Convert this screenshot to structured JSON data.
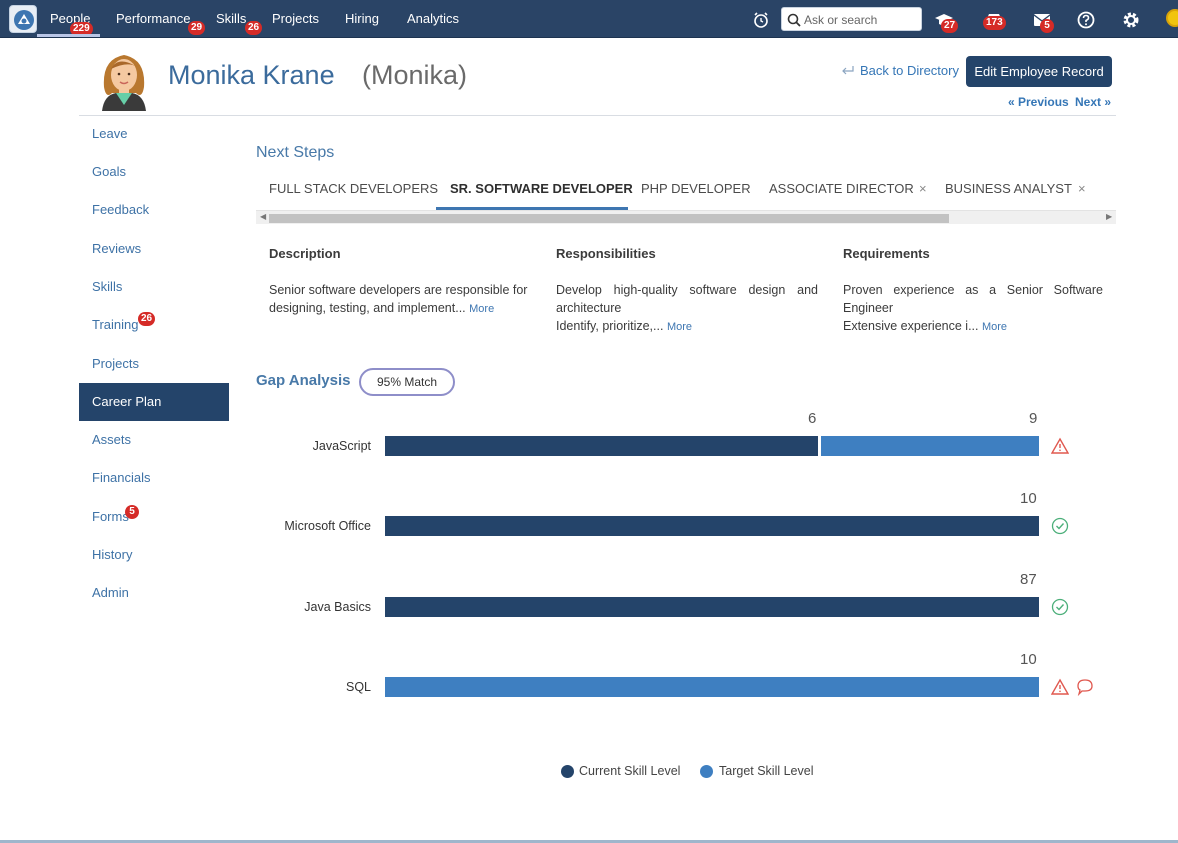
{
  "nav": {
    "items": [
      {
        "label": "People",
        "badge": "229"
      },
      {
        "label": "Performance",
        "badge": "29"
      },
      {
        "label": "Skills",
        "badge": "26"
      },
      {
        "label": "Projects",
        "badge": ""
      },
      {
        "label": "Hiring",
        "badge": ""
      },
      {
        "label": "Analytics",
        "badge": ""
      }
    ],
    "search_placeholder": "Ask or search",
    "icons": {
      "alarm": "alarm-clock-icon",
      "courses": "graduation-cap-icon",
      "courses_badge": "27",
      "inbox": "inbox-icon",
      "inbox_badge": "173",
      "messages": "envelope-icon",
      "messages_badge": "5",
      "help": "help-icon",
      "settings": "gear-icon"
    }
  },
  "header": {
    "name": "Monika Krane",
    "nickname": "(Monika)",
    "back_link": "Back to Directory",
    "edit_button": "Edit Employee Record",
    "previous": "« Previous",
    "next": "Next »"
  },
  "sidebar": {
    "items": [
      {
        "label": "Leave",
        "badge": ""
      },
      {
        "label": "Goals",
        "badge": ""
      },
      {
        "label": "Feedback",
        "badge": ""
      },
      {
        "label": "Reviews",
        "badge": ""
      },
      {
        "label": "Skills",
        "badge": ""
      },
      {
        "label": "Training",
        "badge": "26"
      },
      {
        "label": "Projects",
        "badge": ""
      },
      {
        "label": "Career Plan",
        "badge": ""
      },
      {
        "label": "Assets",
        "badge": ""
      },
      {
        "label": "Financials",
        "badge": ""
      },
      {
        "label": "Forms",
        "badge": "5"
      },
      {
        "label": "History",
        "badge": ""
      },
      {
        "label": "Admin",
        "badge": ""
      }
    ],
    "active": "Career Plan"
  },
  "next_steps": {
    "title": "Next Steps",
    "tabs": [
      {
        "label": "FULL STACK DEVELOPERS",
        "closable": false
      },
      {
        "label": "SR. SOFTWARE DEVELOPER",
        "closable": false
      },
      {
        "label": "PHP DEVELOPER",
        "closable": false
      },
      {
        "label": "ASSOCIATE DIRECTOR",
        "closable": true
      },
      {
        "label": "BUSINESS ANALYST",
        "closable": true
      }
    ],
    "active_tab": "SR. SOFTWARE DEVELOPER",
    "close_glyph": "×",
    "columns": [
      {
        "heading": "Description",
        "text": "Senior software developers are responsible for designing, testing, and implement...",
        "more": "More"
      },
      {
        "heading": "Responsibilities",
        "text": "Develop high-quality software design and architecture\nIdentify, prioritize,...",
        "more": "More"
      },
      {
        "heading": "Requirements",
        "text": "Proven experience as a Senior Software Engineer\nExtensive experience i...",
        "more": "More"
      }
    ]
  },
  "gap_analysis": {
    "title": "Gap Analysis",
    "match": "95% Match"
  },
  "chart_data": {
    "type": "bar",
    "orientation": "horizontal",
    "stacked": true,
    "categories": [
      "JavaScript",
      "Microsoft Office",
      "Java Basics",
      "SQL"
    ],
    "series": [
      {
        "name": "Current Skill Level",
        "color": "#24446a",
        "values": [
          6,
          10,
          87,
          0
        ]
      },
      {
        "name": "Target Skill Level",
        "color": "#3e7fc1",
        "values": [
          3,
          0,
          0,
          10
        ]
      }
    ],
    "value_labels": [
      [
        "6",
        "9"
      ],
      [
        "10"
      ],
      [
        "87"
      ],
      [
        "10"
      ]
    ],
    "status": [
      "warning-icon",
      "check-icon",
      "check-icon",
      "warning-icon"
    ],
    "extra_icons": [
      "",
      "",
      "",
      "comment-icon"
    ],
    "legend_position": "bottom"
  },
  "colors": {
    "nav_bg": "#2a4466",
    "accent": "#3e76b1",
    "dark": "#24446a",
    "warning": "#e0584f",
    "ok": "#4caf7a"
  }
}
